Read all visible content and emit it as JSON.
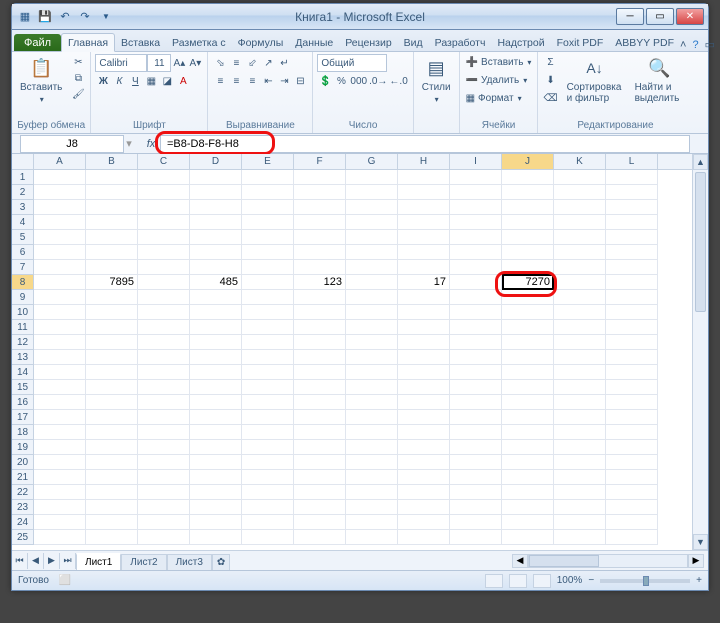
{
  "title": "Книга1 - Microsoft Excel",
  "tabs": {
    "file": "Файл",
    "items": [
      "Главная",
      "Вставка",
      "Разметка с",
      "Формулы",
      "Данные",
      "Рецензир",
      "Вид",
      "Разработч",
      "Надстрой",
      "Foxit PDF",
      "ABBYY PDF"
    ]
  },
  "ribbon": {
    "clipboard": {
      "title": "Буфер обмена",
      "paste": "Вставить"
    },
    "font": {
      "title": "Шрифт",
      "name": "Calibri",
      "size": "11"
    },
    "alignment": {
      "title": "Выравнивание"
    },
    "number": {
      "title": "Число",
      "format": "Общий"
    },
    "styles": {
      "title": "",
      "label": "Стили"
    },
    "cells": {
      "title": "Ячейки",
      "insert": "Вставить",
      "delete": "Удалить",
      "format": "Формат"
    },
    "editing": {
      "title": "Редактирование",
      "sort": "Сортировка и фильтр",
      "find": "Найти и выделить"
    }
  },
  "namebox": "J8",
  "formula": "=B8-D8-F8-H8",
  "columns": [
    "A",
    "B",
    "C",
    "D",
    "E",
    "F",
    "G",
    "H",
    "I",
    "J",
    "K",
    "L"
  ],
  "row_count": 25,
  "data_row": 8,
  "data": {
    "B": "7895",
    "D": "485",
    "F": "123",
    "H": "17",
    "J": "7270"
  },
  "selected": {
    "col": "J",
    "row": 8
  },
  "sheets": [
    "Лист1",
    "Лист2",
    "Лист3"
  ],
  "status": {
    "ready": "Готово",
    "zoom": "100%"
  }
}
